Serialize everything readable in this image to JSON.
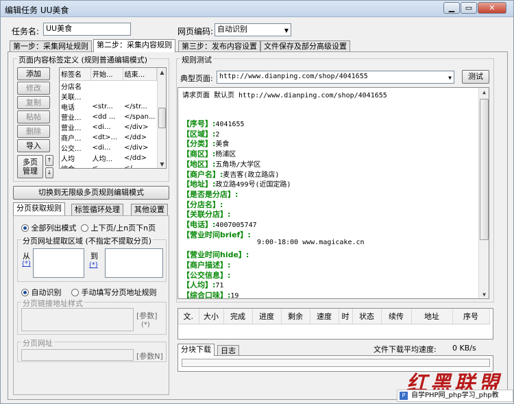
{
  "window": {
    "title": "编辑任务 UU美食"
  },
  "task": {
    "name_label": "任务名:",
    "name_value": "UU美食",
    "encoding_label": "网页编码:",
    "encoding_value": "自动识别"
  },
  "main_tabs": [
    "第一步：采集网址规则",
    "第二步：采集内容规则",
    "第三步：发布内容设置",
    "文件保存及部分高级设置"
  ],
  "tag_section": {
    "title": "页面内容标签定义  (规则普通编辑模式)",
    "buttons": [
      "添加",
      "修改",
      "复制",
      "粘帖",
      "删除",
      "导入"
    ],
    "multipage_button": [
      "多页",
      "管理"
    ],
    "columns": [
      "标签名",
      "开始...",
      "结束..."
    ],
    "rows": [
      [
        "分店名",
        "",
        ""
      ],
      [
        "关联...",
        "",
        ""
      ],
      [
        "电话",
        "<str...",
        "</str..."
      ],
      [
        "营业...",
        "<dd ...",
        "</span..."
      ],
      [
        "营业...",
        "<di...",
        "</div>"
      ],
      [
        "商户...",
        "<dt>...",
        "</dd>"
      ],
      [
        "公交...",
        "<di...",
        "</div>"
      ],
      [
        "人均",
        "人均...",
        "</dd>"
      ],
      [
        "综合...",
        "<...",
        "</..."
      ]
    ]
  },
  "switch_button": "切换到无限级多页规则编辑模式",
  "sub_tabs": [
    "分页获取规则",
    "标签循环处理",
    "其他设置"
  ],
  "paging": {
    "radio_all": "全部列出模式",
    "radio_prev_next": "上下页/上n页下n页",
    "extract_title": "分页网址提取区域 (不指定不提取分页)",
    "from_label": "从",
    "to_label": "到",
    "param": "(*)",
    "radio_auto": "自动识别",
    "radio_manual": "手动填写分页地址规则",
    "link_style_label": "分页链接地址样式",
    "param_btn": "[参数]",
    "param_star": "(*)",
    "page_url_label": "分页网址",
    "param_n": "[参数N]"
  },
  "rule_test": {
    "title": "规则测试",
    "page_label": "典型页面:",
    "page_url": "http://www.dianping.com/shop/4041655",
    "test_button": "测试",
    "result_header": "请求页面 默认页 http://www.dianping.com/shop/4041655",
    "results": [
      {
        "key": "【序号】:",
        "value": "4041655"
      },
      {
        "key": "【区域】:",
        "value": "2"
      },
      {
        "key": "【分类】:",
        "value": "美食"
      },
      {
        "key": "【商区】:",
        "value": "杨浦区"
      },
      {
        "key": "【地区】:",
        "value": "五角场/大学区"
      },
      {
        "key": "【商户名】:",
        "value": "麦吉客(政立路店)"
      },
      {
        "key": "【地址】:",
        "value": "政立路499号(近国定路)"
      },
      {
        "key": "【是否是分店】:",
        "value": ""
      },
      {
        "key": "【分店名】:",
        "value": ""
      },
      {
        "key": "【关联分店】:",
        "value": ""
      },
      {
        "key": "【电话】:",
        "value": "4007005747"
      },
      {
        "key": "【营业时间brief】:",
        "value": ""
      },
      {
        "key": "",
        "value": "9:00-18:00 www.magicake.cn"
      },
      {
        "key": "【营业时间hide】:",
        "value": ""
      },
      {
        "key": "【商户描述】:",
        "value": ""
      },
      {
        "key": "【公交信息】:",
        "value": ""
      },
      {
        "key": "【人均】:",
        "value": "71"
      },
      {
        "key": "【综合口味】:",
        "value": "19"
      }
    ]
  },
  "download": {
    "columns": [
      "文.",
      "大小",
      "完成",
      "进度",
      "剩余",
      "速度",
      "时",
      "状态",
      "续传",
      "地址",
      "序号"
    ],
    "tabs": [
      "分块下载",
      "日志"
    ],
    "speed_label": "文件下载平均速度:",
    "speed_value": "0 KB/s"
  },
  "watermark": {
    "brand": "红黑联盟",
    "site": "自学PHP网_php学习_php教"
  }
}
